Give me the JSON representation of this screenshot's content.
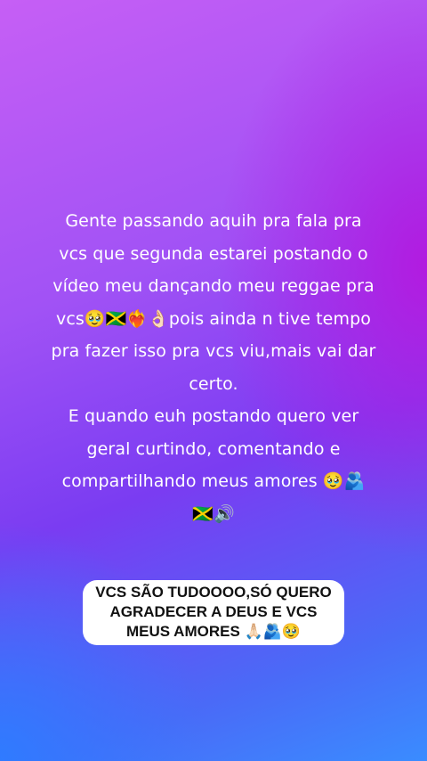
{
  "story": {
    "text": "Gente passando aquih pra fala pra\nvcs que segunda estarei postando o\nvídeo meu dançando meu reggae pra\nvcs🥹🇯🇲❤️‍🔥👌🏻pois ainda n tive tempo\npra fazer isso pra vcs viu,mais vai dar\ncerto.\nE quando euh postando quero ver\ngeral curtindo, comentando e\ncompartilhando meus amores 🥹🫂\n🇯🇲🔊"
  },
  "caption": {
    "text": "VCS SÃO TUDOOOO,SÓ QUERO\nAGRADECER A DEUS E VCS\nMEUS AMORES 🙏🏻🫂🥹"
  },
  "colors": {
    "background_top": "#c65ff5",
    "background_mid": "#a152f5",
    "background_right": "#b21be0",
    "background_bottom": "#3a8cff",
    "text": "#ffffff",
    "caption_bg": "#ffffff",
    "caption_text": "#111111"
  }
}
